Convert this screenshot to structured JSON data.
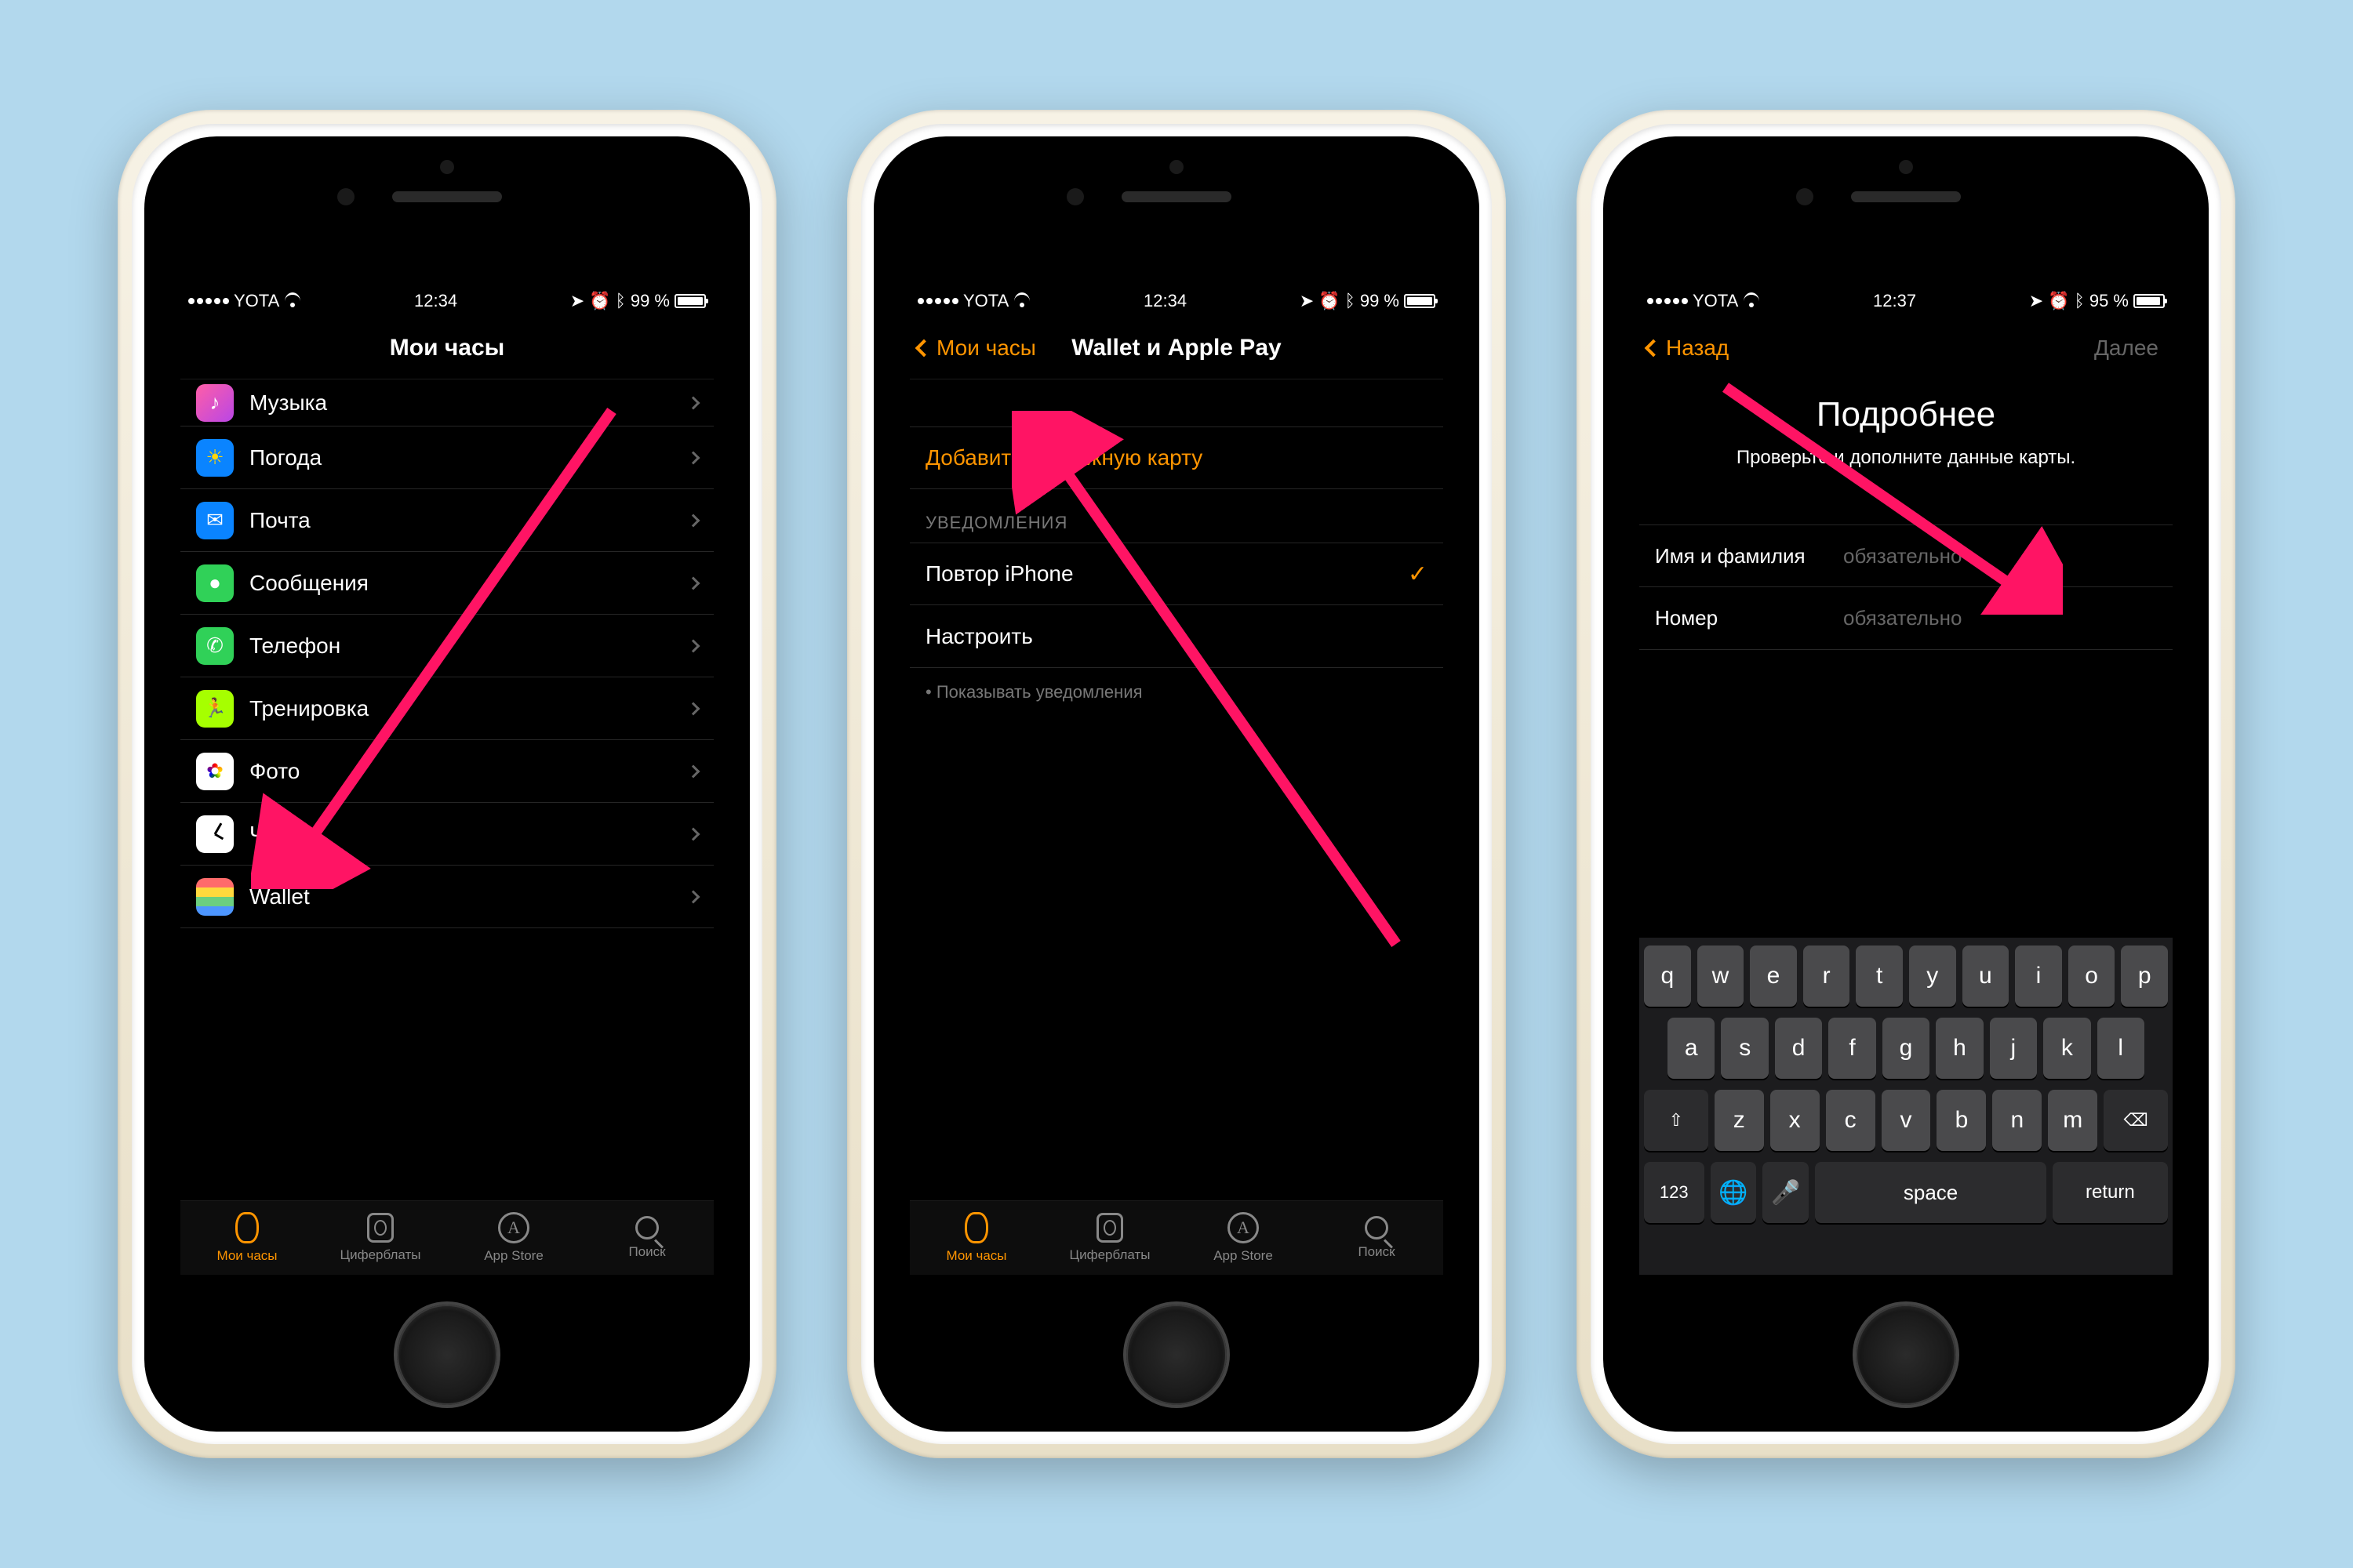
{
  "status": {
    "carrier": "YOTA",
    "time1": "12:34",
    "time3": "12:37",
    "batt1": "99 %",
    "batt3": "95 %"
  },
  "screen1": {
    "title": "Мои часы",
    "rows": [
      {
        "label": "Музыка",
        "icon": "music"
      },
      {
        "label": "Погода",
        "icon": "weather"
      },
      {
        "label": "Почта",
        "icon": "mail"
      },
      {
        "label": "Сообщения",
        "icon": "msg"
      },
      {
        "label": "Телефон",
        "icon": "phone"
      },
      {
        "label": "Тренировка",
        "icon": "workout"
      },
      {
        "label": "Фото",
        "icon": "photos"
      },
      {
        "label": "Часы",
        "icon": "clock"
      },
      {
        "label": "Wallet",
        "icon": "wallet"
      }
    ]
  },
  "tabs": {
    "t1": "Мои часы",
    "t2": "Циферблаты",
    "t3": "App Store",
    "t4": "Поиск"
  },
  "screen2": {
    "back": "Мои часы",
    "title": "Wallet и Apple Pay",
    "add": "Добавить платежную карту",
    "section": "УВЕДОМЛЕНИЯ",
    "repeat": "Повтор iPhone",
    "custom": "Настроить",
    "note": "• Показывать уведомления"
  },
  "screen3": {
    "back": "Назад",
    "next": "Далее",
    "title": "Подробнее",
    "subtitle": "Проверьте и дополните данные карты.",
    "name_label": "Имя и фамилия",
    "name_ph": "обязательно",
    "num_label": "Номер",
    "num_ph": "обязательно"
  },
  "keys": {
    "r1": [
      "q",
      "w",
      "e",
      "r",
      "t",
      "y",
      "u",
      "i",
      "o",
      "p"
    ],
    "r2": [
      "a",
      "s",
      "d",
      "f",
      "g",
      "h",
      "j",
      "k",
      "l"
    ],
    "r3": [
      "z",
      "x",
      "c",
      "v",
      "b",
      "n",
      "m"
    ],
    "shift": "⇧",
    "bksp": "⌫",
    "num": "123",
    "globe": "🌐",
    "mic": "🎤",
    "space": "space",
    "return": "return"
  }
}
